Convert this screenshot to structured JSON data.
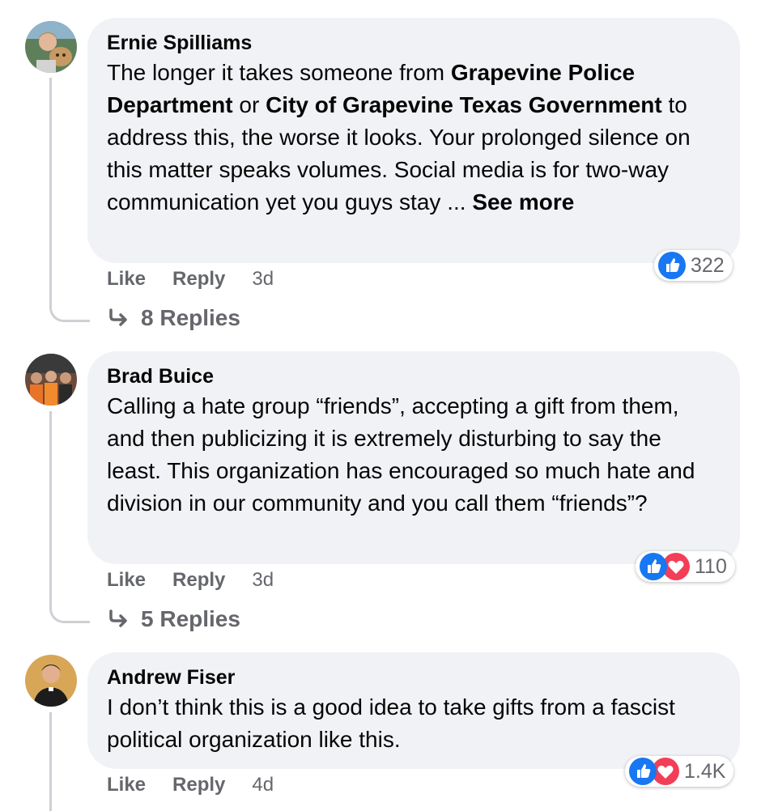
{
  "comments": [
    {
      "author": "Ernie Spilliams",
      "text": {
        "p1": "The longer it takes someone from ",
        "b1": "Grapevine Police Department",
        "p2": " or ",
        "b2": "City of Grapevine Texas Government",
        "p3": " to address this, the worse it looks. Your prolonged silence on this matter speaks volumes. Social media is for two-way communication yet you guys stay ... ",
        "see_more": "See more"
      },
      "reaction_count": "322",
      "reactions": [
        "like-icon"
      ],
      "like_label": "Like",
      "reply_label": "Reply",
      "time": "3d",
      "replies_label": "8 Replies"
    },
    {
      "author": "Brad Buice",
      "text": "Calling a hate group “friends”, accepting a gift from them, and then publicizing it is extremely disturbing to say the least. This organization has encouraged so much hate and division in our community and you call them “friends”?",
      "reaction_count": "110",
      "reactions": [
        "like-icon",
        "love-icon"
      ],
      "like_label": "Like",
      "reply_label": "Reply",
      "time": "3d",
      "replies_label": "5 Replies"
    },
    {
      "author": "Andrew Fiser",
      "text": "I don’t think this is a good idea to take gifts from a fascist political organization like this.",
      "reaction_count": "1.4K",
      "reactions": [
        "like-icon",
        "love-icon"
      ],
      "like_label": "Like",
      "reply_label": "Reply",
      "time": "4d"
    }
  ],
  "colors": {
    "bubble": "#f0f2f5",
    "like_blue": "#1877f2",
    "love_red": "#f33e58",
    "secondary_text": "#65676b"
  }
}
